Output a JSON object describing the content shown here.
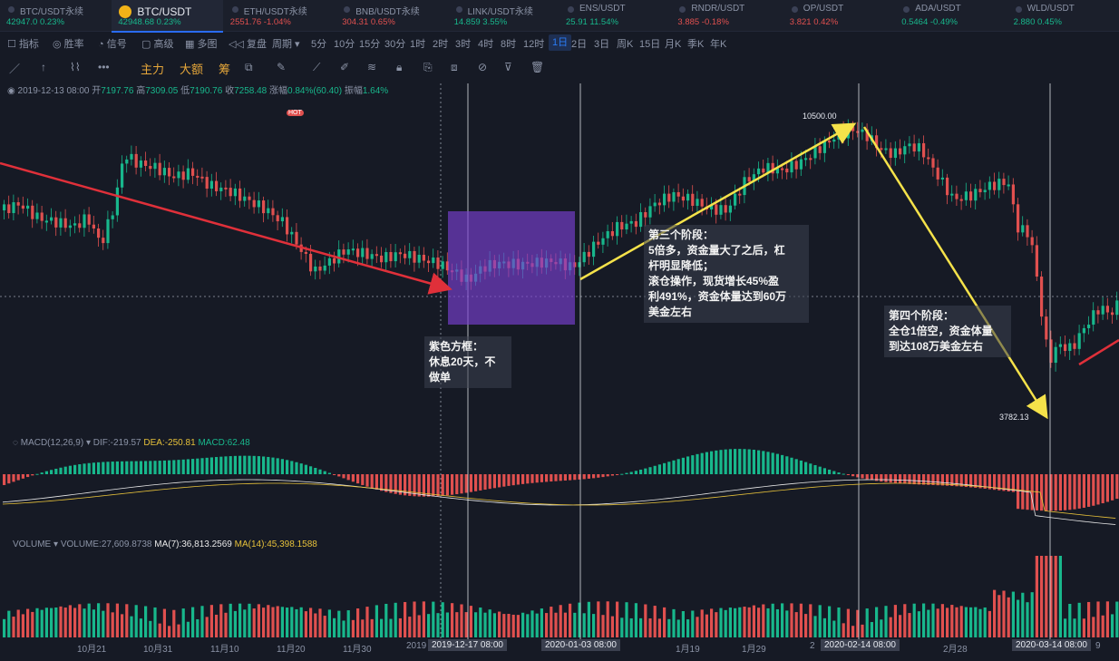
{
  "tickers": [
    {
      "name": "BTC/USDT永续",
      "price": "42947.0",
      "change": "0.23%",
      "dir": "up"
    },
    {
      "name": "BTC/USDT",
      "price": "42948.68",
      "change": "0.23%",
      "dir": "up",
      "active": true
    },
    {
      "name": "ETH/USDT永续",
      "price": "2551.76",
      "change": "-1.04%",
      "dir": "down"
    },
    {
      "name": "BNB/USDT永续",
      "price": "304.31",
      "change": "0.65%",
      "dir": "down"
    },
    {
      "name": "LINK/USDT永续",
      "price": "14.859",
      "change": "3.55%",
      "dir": "up"
    },
    {
      "name": "ENS/USDT",
      "price": "25.91",
      "change": "11.54%",
      "dir": "up"
    },
    {
      "name": "RNDR/USDT",
      "price": "3.885",
      "change": "-0.18%",
      "dir": "down"
    },
    {
      "name": "OP/USDT",
      "price": "3.821",
      "change": "0.42%",
      "dir": "down"
    },
    {
      "name": "ADA/USDT",
      "price": "0.5464",
      "change": "-0.49%",
      "dir": "up"
    },
    {
      "name": "WLD/USDT",
      "price": "2.880",
      "change": "0.45%",
      "dir": "up"
    }
  ],
  "toolbar": {
    "indicators": "指标",
    "winrate": "胜率",
    "signal": "信号",
    "advanced": "高级",
    "multi": "多图",
    "replay": "复盘",
    "period": "周期",
    "intervals": [
      "5分",
      "10分",
      "15分",
      "30分",
      "1时",
      "2时",
      "3时",
      "4时",
      "8时",
      "12时",
      "1日",
      "2日",
      "3日",
      "周K",
      "15日",
      "月K",
      "季K",
      "年K"
    ],
    "selected_interval": "1日"
  },
  "drawbar": {
    "main": "主力",
    "big": "大额",
    "chip": "筹",
    "hot": "HOT"
  },
  "ohlc": {
    "date": "2019-12-13 08:00",
    "open_label": "开",
    "open": "7197.76",
    "high_label": "高",
    "high": "7309.05",
    "low_label": "低",
    "low": "7190.76",
    "close_label": "收",
    "close": "7258.48",
    "chg_label": "涨幅",
    "chg": "0.84%(60.40)",
    "amp_label": "振幅",
    "amp": "1.64%"
  },
  "annotations": {
    "box": "紫色方框：\n休息20天，不\n做单",
    "stage3": "第三个阶段：\n5倍多，资金量大了之后，杠\n杆明显降低；\n滚仓操作，现货增长45%盈\n利491%，资金体量达到60万\n美金左右",
    "stage4": "第四个阶段：\n全仓1倍空，资金体量\n到达108万美金左右",
    "high_flag": "10500.00",
    "low_flag": "3782.13"
  },
  "macd": {
    "label": "MACD(12,26,9)",
    "dif": "DIF:-219.57",
    "dea": "DEA:-250.81",
    "macd": "MACD:62.48"
  },
  "volume": {
    "label": "VOLUME",
    "vol": "VOLUME:27,609.8738",
    "ma7": "MA(7):36,813.2569",
    "ma14": "MA(14):45,398.1588"
  },
  "xaxis": {
    "labels": [
      "10月21",
      "10月31",
      "11月10",
      "11月20",
      "11月30",
      "2019",
      "1月19",
      "1月29",
      "2",
      "2月28",
      "9"
    ],
    "flags": [
      "2019-12-17 08:00",
      "2020-01-03 08:00",
      "2020-02-14 08:00",
      "2020-03-14 08:00"
    ]
  },
  "colors": {
    "up": "#18b78c",
    "down": "#e0504f",
    "accent": "#2a7bf5",
    "arrow_red": "#e0303a",
    "arrow_yellow": "#f5e24a",
    "box": "#7a3fd1"
  }
}
